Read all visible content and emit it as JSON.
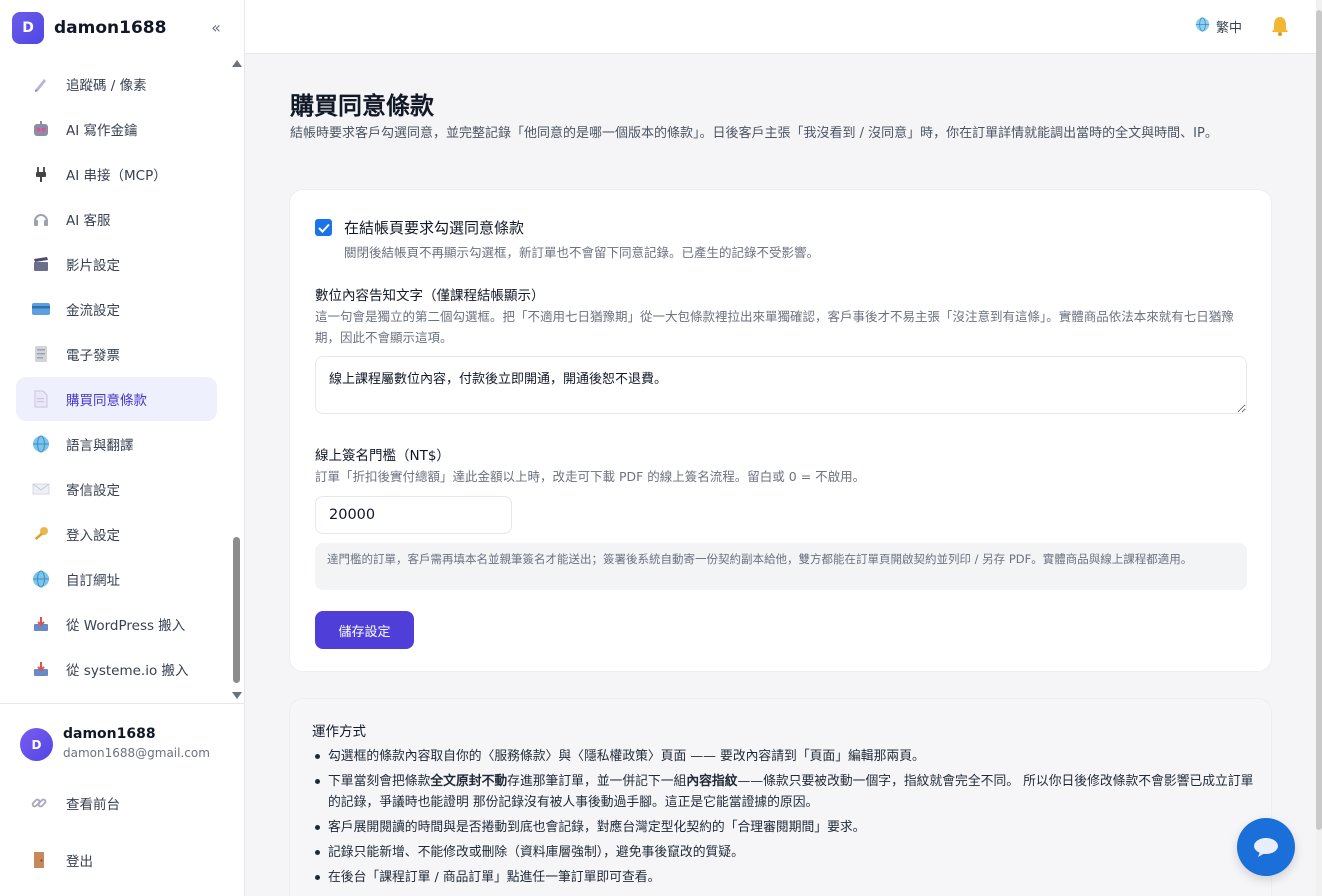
{
  "sidebar": {
    "brand_initial": "D",
    "brand_name": "damon1688",
    "collapse": "«",
    "items": [
      {
        "label": "追蹤碼 / 像素",
        "icon": "pen-icon"
      },
      {
        "label": "AI 寫作金鑰",
        "icon": "robot-icon"
      },
      {
        "label": "AI 串接（MCP）",
        "icon": "plug-icon"
      },
      {
        "label": "AI 客服",
        "icon": "headphones-icon"
      },
      {
        "label": "影片設定",
        "icon": "clapper-icon"
      },
      {
        "label": "金流設定",
        "icon": "credit-card-icon"
      },
      {
        "label": "電子發票",
        "icon": "receipt-icon"
      },
      {
        "label": "購買同意條款",
        "icon": "document-icon",
        "active": true
      },
      {
        "label": "語言與翻譯",
        "icon": "globe-icon"
      },
      {
        "label": "寄信設定",
        "icon": "envelope-icon"
      },
      {
        "label": "登入設定",
        "icon": "key-icon"
      },
      {
        "label": "自訂網址",
        "icon": "globe-icon"
      },
      {
        "label": "從 WordPress 搬入",
        "icon": "inbox-tray-icon"
      },
      {
        "label": "從 systeme.io 搬入",
        "icon": "inbox-tray-icon"
      }
    ],
    "user": {
      "initial": "D",
      "name": "damon1688",
      "email": "damon1688@gmail.com"
    },
    "footer": {
      "view_frontend": "查看前台",
      "logout": "登出"
    }
  },
  "topbar": {
    "language": "繁中"
  },
  "main": {
    "title": "購買同意條款",
    "description": "結帳時要求客戶勾選同意，並完整記錄「他同意的是哪一個版本的條款」。日後客戶主張「我沒看到 / 沒同意」時，你在訂單詳情就能調出當時的全文與時間、IP。",
    "checkbox": {
      "checked": true,
      "label": "在結帳頁要求勾選同意條款",
      "help": "關閉後結帳頁不再顯示勾選框，新訂單也不會留下同意記錄。已產生的記錄不受影響。"
    },
    "digital_notice": {
      "label": "數位內容告知文字（僅課程結帳顯示）",
      "help": "這一句會是獨立的第二個勾選框。把「不適用七日猶豫期」從一大包條款裡拉出來單獨確認，客戶事後才不易主張「沒注意到有這條」。實體商品依法本來就有七日猶豫期，因此不會顯示這項。",
      "value": "線上課程屬數位內容，付款後立即開通，開通後恕不退費。"
    },
    "signature": {
      "label": "線上簽名門檻（NT$）",
      "help": "訂單「折扣後實付總額」達此金額以上時，改走可下載 PDF 的線上簽名流程。留白或 0 = 不啟用。",
      "value": "20000",
      "note": "達門檻的訂單，客戶需再填本名並親筆簽名才能送出；簽署後系統自動寄一份契約副本給他，雙方都能在訂單頁開啟契約並列印 / 另存 PDF。實體商品與線上課程都適用。"
    },
    "save_label": "儲存設定",
    "howto": {
      "title": "運作方式",
      "items": [
        {
          "pre": "勾選框的條款內容取自你的〈服務條款〉與〈隱私權政策〉頁面 —— 要改內容請到「頁面」編輯那兩頁。",
          "b1": "",
          "mid": "",
          "b2": "",
          "post": ""
        },
        {
          "pre": "下單當刻會把條款",
          "b1": "全文原封不動",
          "mid": "存進那筆訂單，並一併記下一組",
          "b2": "內容指紋",
          "post": "——條款只要被改動一個字，指紋就會完全不同。 所以你日後修改條款不會影響已成立訂單的記錄，爭議時也能證明 那份記錄沒有被人事後動過手腳。這正是它能當證據的原因。"
        },
        {
          "pre": "客戶展開閱讀的時間與是否捲動到底也會記錄，對應台灣定型化契約的「合理審閱期間」要求。",
          "b1": "",
          "mid": "",
          "b2": "",
          "post": ""
        },
        {
          "pre": "記錄只能新增、不能修改或刪除（資料庫層強制），避免事後竄改的質疑。",
          "b1": "",
          "mid": "",
          "b2": "",
          "post": ""
        },
        {
          "pre": "在後台「課程訂單 / 商品訂單」點進任一筆訂單即可查看。",
          "b1": "",
          "mid": "",
          "b2": "",
          "post": ""
        }
      ]
    }
  },
  "colors": {
    "accent": "#4f3fd8",
    "active_bg": "#eef0fe",
    "checkbox": "#1a73e8",
    "chat": "#1a6fd8"
  }
}
